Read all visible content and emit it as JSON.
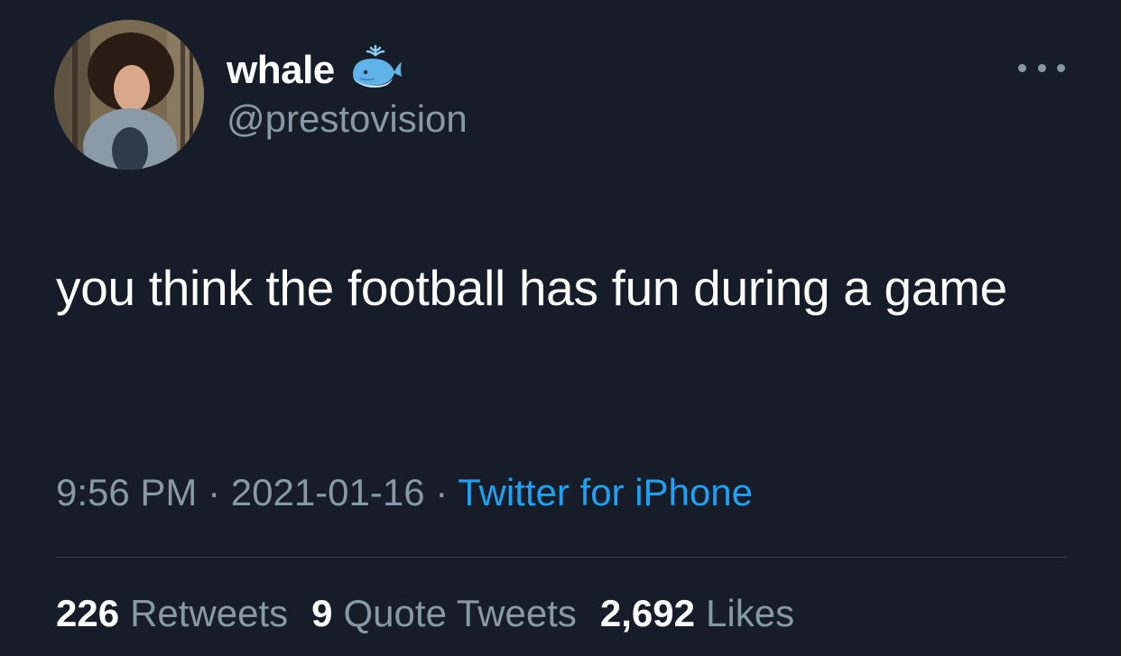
{
  "author": {
    "display_name": "whale",
    "handle": "@prestovision",
    "name_emoji": "whale-emoji-icon"
  },
  "tweet": {
    "text": "you think the football has fun during a game"
  },
  "meta": {
    "time": "9:56 PM",
    "separator": "·",
    "date": "2021-01-16",
    "source": "Twitter for iPhone"
  },
  "stats": {
    "retweets_count": "226",
    "retweets_label": "Retweets",
    "quotes_count": "9",
    "quotes_label": "Quote Tweets",
    "likes_count": "2,692",
    "likes_label": "Likes"
  },
  "colors": {
    "background": "#161d28",
    "primary_text": "#ffffff",
    "secondary_text": "#8899a6",
    "link": "#1da1f2",
    "divider": "#38444d"
  },
  "icons": {
    "more": "more-options-icon"
  }
}
